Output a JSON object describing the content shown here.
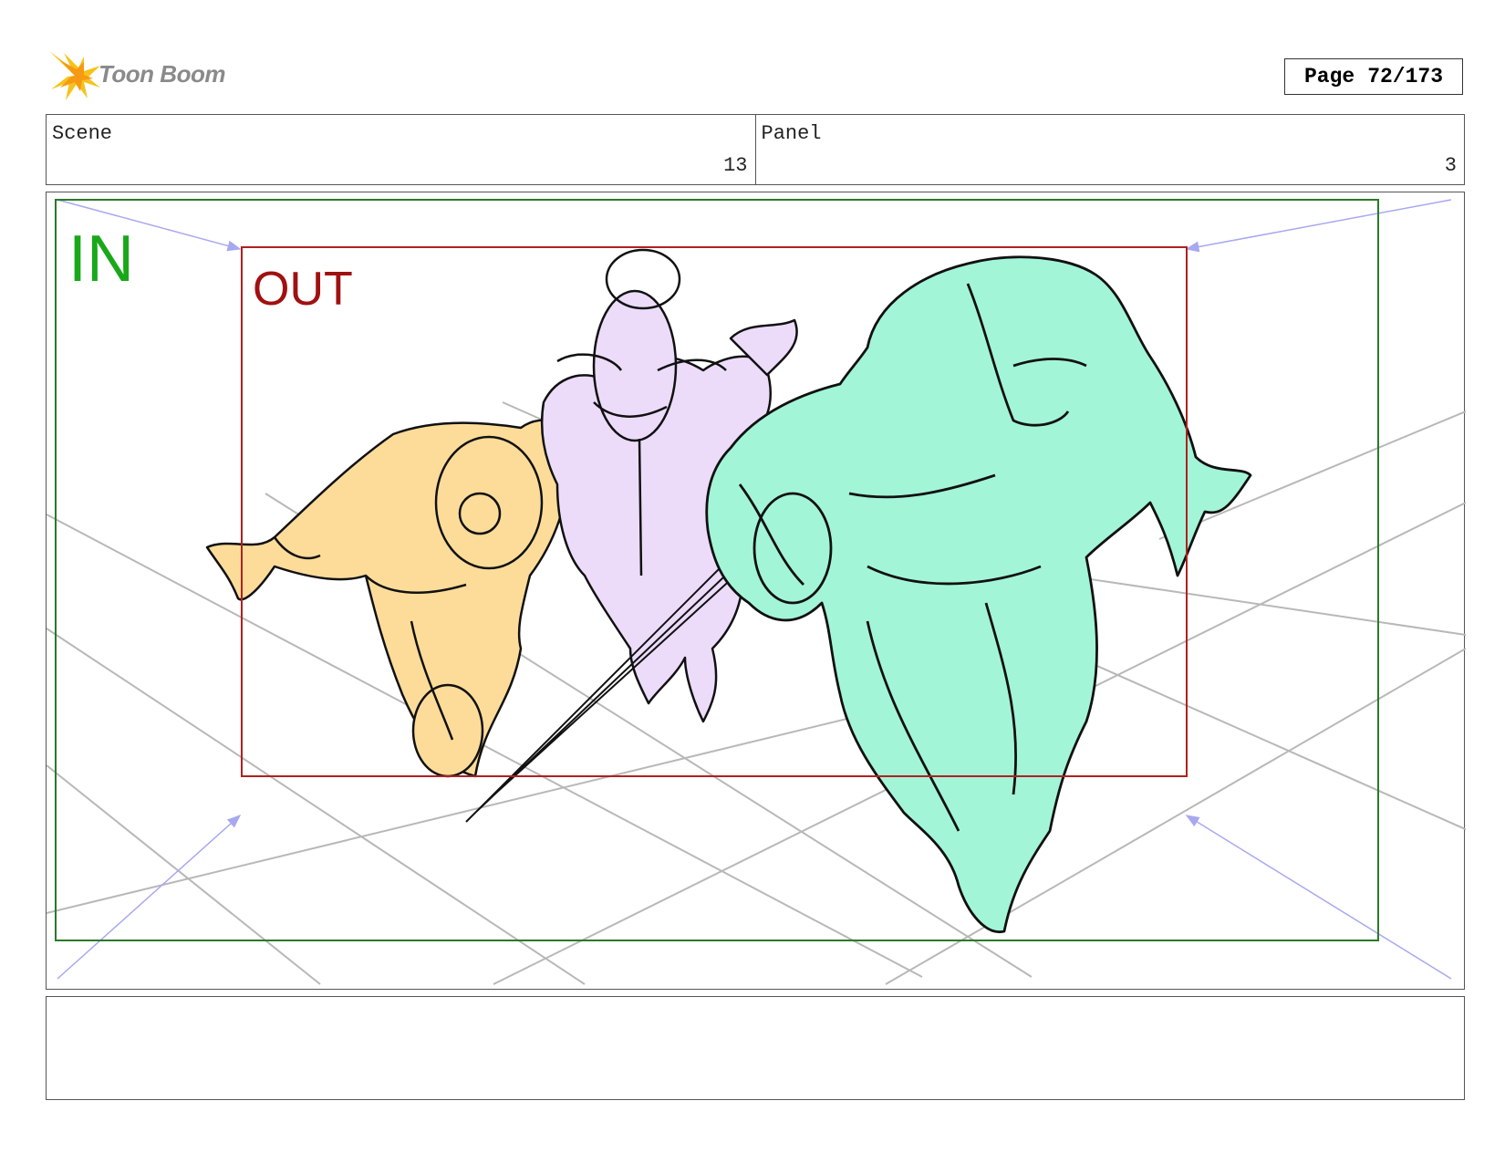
{
  "header": {
    "logo_text": "Toon Boom",
    "page_label": "Page",
    "page_number": "72/173"
  },
  "info": {
    "scene_label": "Scene",
    "scene_value": "13",
    "panel_label": "Panel",
    "panel_value": "3"
  },
  "panel": {
    "in_label": "IN",
    "out_label": "OUT",
    "colors": {
      "in_frame": "#2a7a2a",
      "in_text": "#1aa81a",
      "out_frame": "#b02020",
      "out_text": "#a01010",
      "perspective_lines": "#b8b8b8",
      "camera_arrows": "#a8a8f0",
      "character_left": "#fddc9a",
      "character_middle": "#ecdcfa",
      "character_right": "#a3f5d8"
    }
  },
  "notes": {
    "text": ""
  }
}
